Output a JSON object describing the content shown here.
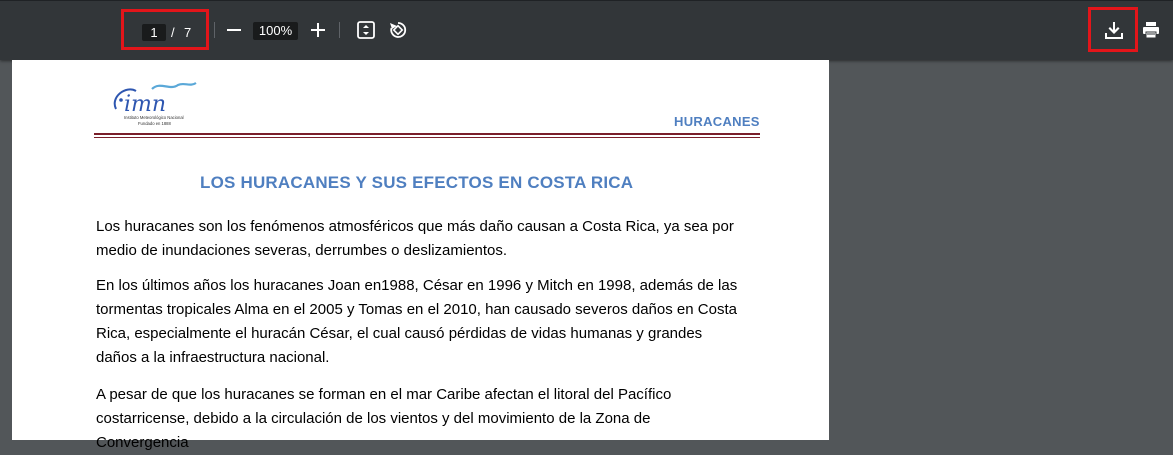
{
  "toolbar": {
    "current_page": "1",
    "page_separator": "/",
    "total_pages": "7",
    "zoom_level": "100%"
  },
  "document": {
    "logo_text": "imn",
    "logo_subtext_1": "Instituto Meteorológico Nacional",
    "logo_subtext_2": "Fundado en 1888",
    "header_title": "HURACANES",
    "title": "LOS HURACANES Y SUS EFECTOS EN COSTA RICA",
    "paragraphs": [
      "Los huracanes son los fenómenos atmosféricos que más daño causan a Costa Rica, ya sea por medio de inundaciones severas, derrumbes o deslizamientos.",
      "En los últimos años los huracanes Joan en1988, César en 1996 y Mitch en 1998, además de las tormentas tropicales Alma en el 2005 y Tomas en el 2010,  han causado severos daños en Costa Rica, especialmente el huracán César, el cual causó pérdidas de vidas humanas y grandes daños a la infraestructura nacional.",
      "A pesar de que los huracanes se forman en el mar Caribe afectan el litoral del Pacífico costarricense, debido a la circulación de los vientos y del movimiento de la Zona de Convergencia"
    ]
  },
  "icons": {
    "zoom_out": "minus-icon",
    "zoom_in": "plus-icon",
    "fit": "fit-page-icon",
    "rotate": "rotate-icon",
    "download": "download-icon",
    "print": "print-icon"
  },
  "colors": {
    "toolbar_bg": "#323639",
    "viewer_bg": "#525659",
    "highlight": "#e3151a",
    "heading_blue": "#4f7fc0",
    "rule": "#7a1f2a"
  }
}
